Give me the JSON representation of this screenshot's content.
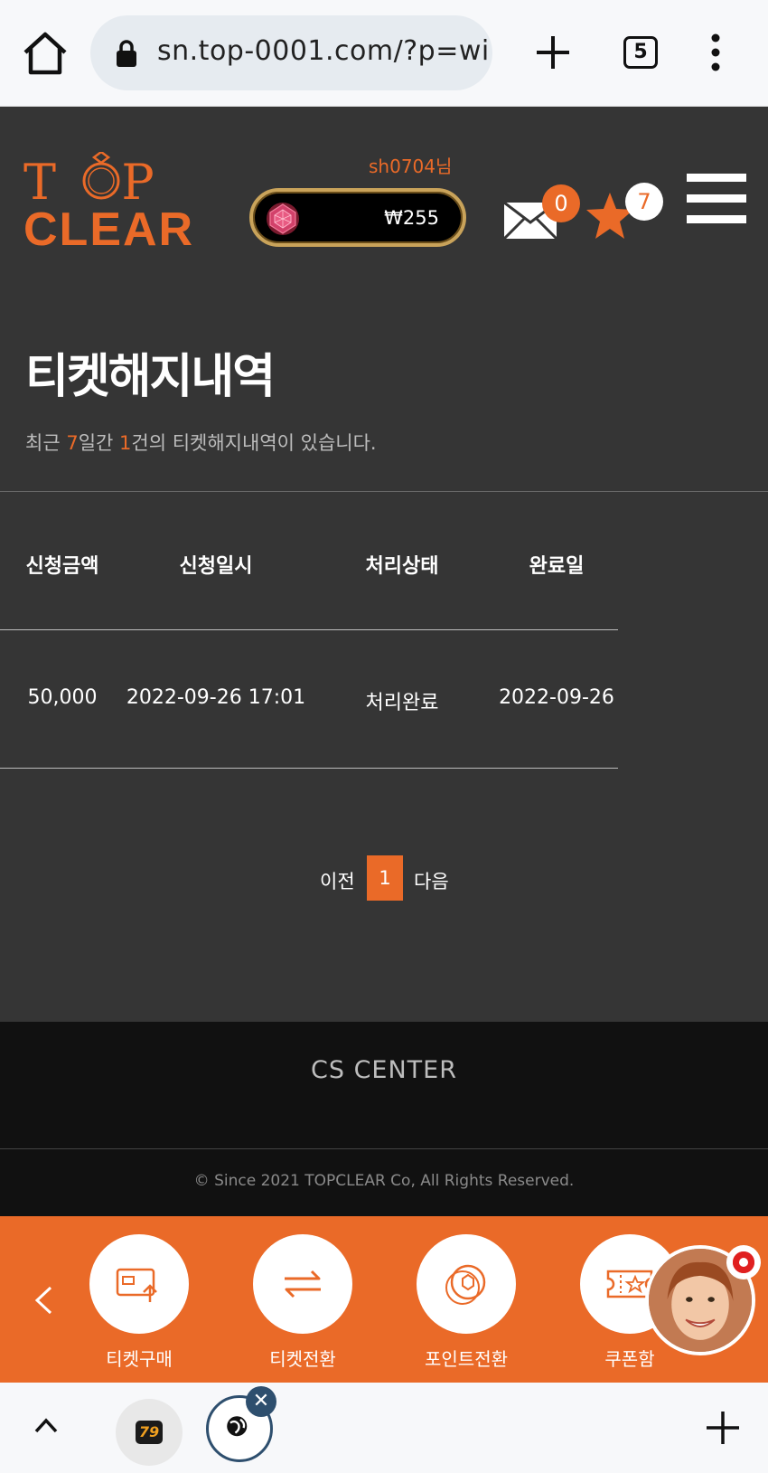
{
  "browser": {
    "url": "sn.top-0001.com/?p=wi",
    "tab_count": "5"
  },
  "header": {
    "logo_top": "TOP",
    "logo_bottom": "CLEAR",
    "username": "sh0704님",
    "balance": "₩255",
    "mail_count": "0",
    "star_count": "7"
  },
  "main": {
    "title": "티켓해지내역",
    "summary": {
      "prefix": "최근 ",
      "days": "7",
      "mid": "일간 ",
      "count": "1",
      "suffix": "건의 티켓해지내역이 있습니다."
    },
    "table": {
      "headers": [
        "신청금액",
        "신청일시",
        "처리상태",
        "완료일"
      ],
      "rows": [
        [
          "50,000",
          "2022-09-26 17:01",
          "처리완료",
          "2022-09-26"
        ]
      ]
    },
    "pagination": {
      "prev": "이전",
      "current": "1",
      "next": "다음"
    }
  },
  "footer": {
    "cs_center": "CS CENTER",
    "copyright": "© Since 2021 TOPCLEAR Co, All Rights Reserved."
  },
  "bottom_nav": {
    "items": [
      {
        "label": "티켓구매",
        "icon": "ticket-buy-icon"
      },
      {
        "label": "티켓전환",
        "icon": "exchange-icon"
      },
      {
        "label": "포인트전환",
        "icon": "coin-icon"
      },
      {
        "label": "쿠폰함",
        "icon": "coupon-icon"
      }
    ]
  },
  "browser_bottom": {
    "tab_label": "79"
  },
  "colors": {
    "accent": "#ea6a28",
    "header_bg": "#353535",
    "footer_bg": "#111111"
  }
}
